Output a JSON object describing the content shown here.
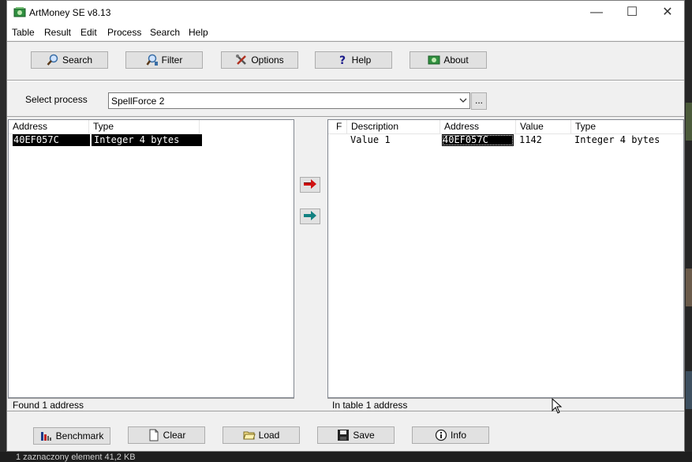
{
  "window": {
    "title": "ArtMoney SE v8.13",
    "controls": {
      "minimize": "—",
      "maximize": "☐",
      "close": "✕"
    }
  },
  "menu": [
    "Table",
    "Result",
    "Edit",
    "Process",
    "Search",
    "Help"
  ],
  "toolbar": {
    "search": "Search",
    "filter": "Filter",
    "options": "Options",
    "help": "Help",
    "about": "About"
  },
  "process": {
    "label": "Select process",
    "selected": "SpellForce 2",
    "browse": "..."
  },
  "found_table": {
    "columns": [
      "Address",
      "Type"
    ],
    "rows": [
      {
        "address": "40EF057C",
        "type": "Integer 4 bytes"
      }
    ],
    "status": "Found 1 address"
  },
  "saved_table": {
    "columns": [
      "F",
      "Description",
      "Address",
      "Value",
      "Type"
    ],
    "rows": [
      {
        "f": "",
        "description": "Value 1",
        "address": "40EF057C",
        "value": "1142",
        "type": "Integer 4 bytes"
      }
    ],
    "status": "In table 1 address"
  },
  "bottom_buttons": {
    "benchmark": "Benchmark",
    "clear": "Clear",
    "load": "Load",
    "save": "Save",
    "info": "Info"
  },
  "taskbar": {
    "text": "1 zaznaczony element  41,2 KB"
  },
  "colors": {
    "selection": "#000000",
    "window_bg": "#f0f0f0",
    "red_arrow": "#d01010",
    "teal_arrow": "#108080"
  }
}
